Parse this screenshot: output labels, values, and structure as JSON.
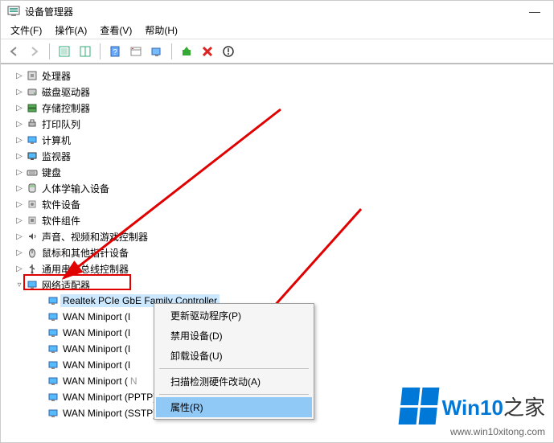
{
  "window": {
    "title": "设备管理器",
    "minimize": "—"
  },
  "menu": {
    "file": "文件(F)",
    "action": "操作(A)",
    "view": "查看(V)",
    "help": "帮助(H)"
  },
  "tree": {
    "cpu": "处理器",
    "disk": "磁盘驱动器",
    "storage": "存储控制器",
    "printqueue": "打印队列",
    "computer": "计算机",
    "monitor": "监视器",
    "keyboard": "键盘",
    "hid": "人体学输入设备",
    "software_device": "软件设备",
    "software_component": "软件组件",
    "sound": "声音、视频和游戏控制器",
    "mouse": "鼠标和其他指针设备",
    "usb": "通用串行总线控制器",
    "network": "网络适配器",
    "net0": "Realtek PCIe GbE Family Controller",
    "net1": "WAN Miniport (I",
    "net2": "WAN Miniport (I",
    "net3": "WAN Miniport (I",
    "net4": "WAN Miniport (I",
    "net5": "WAN Miniport (",
    "net6": "WAN Miniport (PPTP)",
    "net7": "WAN Miniport (SSTP)"
  },
  "net5_suffix": "N",
  "ctx": {
    "update": "更新驱动程序(P)",
    "disable": "禁用设备(D)",
    "uninstall": "卸载设备(U)",
    "scan": "扫描检测硬件改动(A)",
    "properties": "属性(R)"
  },
  "watermark": {
    "brand_pre": "Win10",
    "brand_post": "之家",
    "url": "www.win10xitong.com"
  }
}
